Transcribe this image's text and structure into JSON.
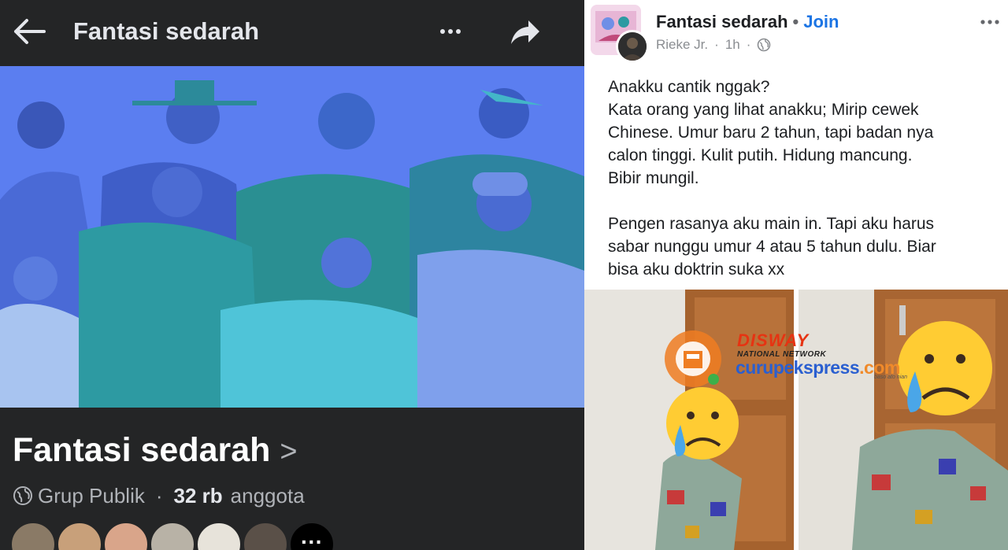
{
  "left_panel": {
    "header": {
      "title": "Fantasi sedarah",
      "back_icon": "arrow-left-icon",
      "more_icon": "more-dots-icon",
      "share_icon": "share-arrow-icon"
    },
    "cover": {
      "description_icon": "group-cover-illustration"
    },
    "group": {
      "name": "Fantasi sedarah",
      "chevron": ">",
      "privacy": "Grup Publik",
      "separator": "·",
      "member_count": "32 rb",
      "member_label": "anggota"
    },
    "member_avatars_more": "···"
  },
  "right_panel": {
    "post_header": {
      "group_name": "Fantasi sedarah",
      "separator": "•",
      "join_label": "Join",
      "author": "Rieke Jr.",
      "dot": "·",
      "time": "1h",
      "audience_icon": "globe-icon"
    },
    "post_text": {
      "paragraph_1": "Anakku cantik nggak?\nKata orang yang lihat anakku; Mirip cewek\nChinese. Umur baru 2 tahun, tapi badan nya\ncalon tinggi. Kulit putih. Hidung mancung.\nBibir mungil.",
      "paragraph_2": "Pengen rasanya aku main in. Tapi aku harus\nsabar nunggu umur 4 atau 5 tahun dulu. Biar\nbisa aku doktrin suka xx"
    },
    "watermark": {
      "brand": "DISWAY",
      "network": "NATIONAL NETWORK",
      "site": "curupekspress",
      "tld": ".com",
      "tagline": "baso ato nian"
    }
  },
  "colors": {
    "dark_bg": "#242526",
    "cover_blue": "#5b7ef0",
    "join_blue": "#1b74e4",
    "brand_red": "#e63312",
    "brand_orange": "#f08a2a"
  }
}
